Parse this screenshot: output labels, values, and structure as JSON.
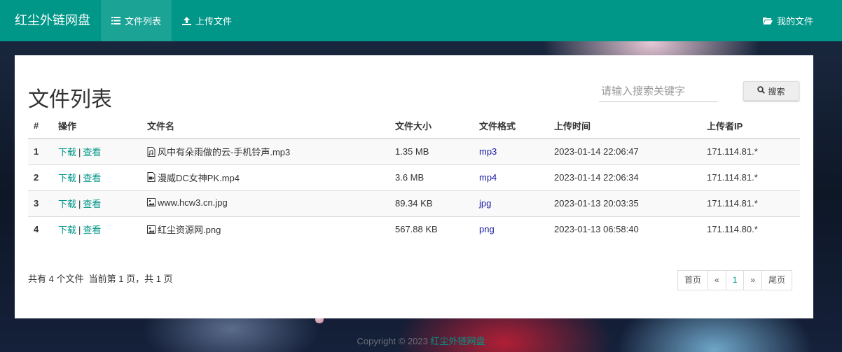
{
  "navbar": {
    "brand": "红尘外链网盘",
    "items": [
      {
        "label": "文件列表",
        "icon": "list-icon",
        "active": true
      },
      {
        "label": "上传文件",
        "icon": "upload-icon",
        "active": false
      }
    ],
    "right": {
      "label": "我的文件",
      "icon": "folder-open-icon"
    }
  },
  "main": {
    "title": "文件列表",
    "search": {
      "placeholder": "请输入搜索关键字",
      "value": "",
      "button_label": "搜索"
    },
    "table": {
      "headers": [
        "#",
        "操作",
        "文件名",
        "文件大小",
        "文件格式",
        "上传时间",
        "上传者IP"
      ],
      "download_label": "下载",
      "view_label": "查看",
      "separator": "|",
      "rows": [
        {
          "num": "1",
          "icon": "audio-file-icon",
          "name": "风中有朵雨做的云-手机铃声.mp3",
          "size": "1.35 MB",
          "format": "mp3",
          "time": "2023-01-14 22:06:47",
          "ip": "171.114.81.*"
        },
        {
          "num": "2",
          "icon": "video-file-icon",
          "name": "漫威DC女神PK.mp4",
          "size": "3.6 MB",
          "format": "mp4",
          "time": "2023-01-14 22:06:34",
          "ip": "171.114.81.*"
        },
        {
          "num": "3",
          "icon": "image-file-icon",
          "name": "www.hcw3.cn.jpg",
          "size": "89.34 KB",
          "format": "jpg",
          "time": "2023-01-13 20:03:35",
          "ip": "171.114.81.*"
        },
        {
          "num": "4",
          "icon": "image-file-icon",
          "name": "红尘资源网.png",
          "size": "567.88 KB",
          "format": "png",
          "time": "2023-01-13 06:58:40",
          "ip": "171.114.80.*"
        }
      ]
    },
    "summary": "共有 4 个文件  当前第 1 页，共 1 页",
    "pagination": {
      "first": "首页",
      "prev": "«",
      "current": "1",
      "next": "»",
      "last": "尾页"
    }
  },
  "footer": {
    "copyright": "Copyright © 2023 ",
    "brand": "红尘外链网盘"
  },
  "colors": {
    "accent": "#009688",
    "format_text": "#1a1aa6"
  }
}
